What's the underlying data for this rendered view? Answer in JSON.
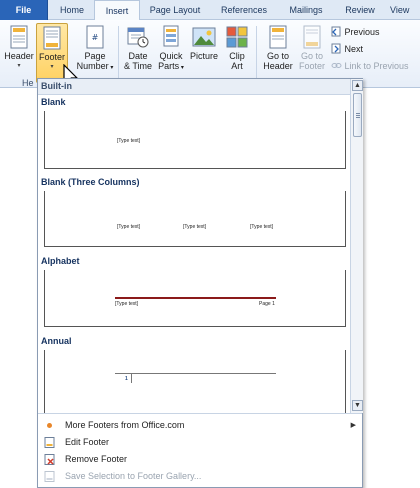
{
  "tabs": [
    "File",
    "Home",
    "Insert",
    "Page Layout",
    "References",
    "Mailings",
    "Review",
    "View"
  ],
  "ribbon": {
    "header_label": "Header",
    "footer_label": "Footer",
    "page_number_label_1": "Page",
    "page_number_label_2": "Number",
    "date_time_label_1": "Date",
    "date_time_label_2": "& Time",
    "quick_parts_label_1": "Quick",
    "quick_parts_label_2": "Parts",
    "picture_label": "Picture",
    "clip_art_label_1": "Clip",
    "clip_art_label_2": "Art",
    "go_to_header_label_1": "Go to",
    "go_to_header_label_2": "Header",
    "go_to_footer_label_1": "Go to",
    "go_to_footer_label_2": "Footer",
    "previous_label": "Previous",
    "next_label": "Next",
    "link_to_previous_label": "Link to Previous",
    "group_label_partial": "He"
  },
  "gallery": {
    "builtin_label": "Built-in",
    "sections": [
      {
        "title": "Blank",
        "placeholders": [
          "[Type text]"
        ]
      },
      {
        "title": "Blank (Three Columns)",
        "placeholders": [
          "[Type text]",
          "[Type text]",
          "[Type text]"
        ]
      },
      {
        "title": "Alphabet",
        "placeholders": [
          "[Type text]",
          "Page 1"
        ]
      },
      {
        "title": "Annual",
        "placeholders": [
          "1"
        ]
      }
    ]
  },
  "menu": {
    "more_footers": "More Footers from Office.com",
    "edit_footer": "Edit Footer",
    "remove_footer": "Remove Footer",
    "save_selection": "Save Selection to Footer Gallery..."
  },
  "colors": {
    "file_tab": "#2a65b8",
    "pressed_button": "#ffd161",
    "alphabet_rule": "#8b1a1a"
  }
}
